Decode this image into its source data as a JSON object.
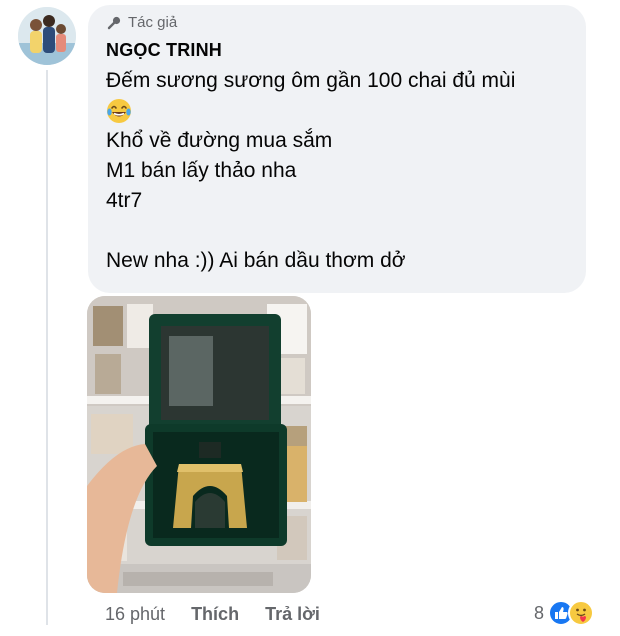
{
  "comment": {
    "role_label": "Tác giả",
    "author": "NGỌC TRINH",
    "lines": [
      "Đếm sương sương ôm gần 100 chai đủ mùi",
      "",
      "Khổ về đường mua sắm",
      "M1 bán lấy thảo nha",
      "4tr7",
      "",
      "New nha :)) Ai bán dầu thơm dở"
    ],
    "emoji_name": "laughing-tears-emoji",
    "attachment_icon": "perfume-photo"
  },
  "footer": {
    "time": "16 phút",
    "like_label": "Thích",
    "reply_label": "Trả lời",
    "reaction_count": "8",
    "reaction_icons": [
      "like-reaction-icon",
      "care-reaction-icon"
    ]
  },
  "colors": {
    "bubble": "#f0f2f5",
    "secondary_text": "#65676b",
    "like_blue": "#1877f2",
    "perfume_box_green": "#0f3b2c",
    "perfume_gold": "#c9a74e"
  }
}
